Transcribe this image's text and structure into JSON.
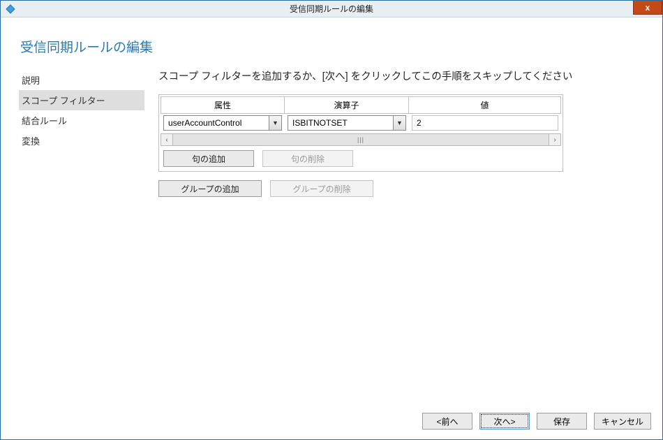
{
  "window": {
    "title": "受信同期ルールの編集",
    "close_label": "x"
  },
  "heading": "受信同期ルールの編集",
  "sidebar": {
    "items": [
      {
        "label": "説明",
        "selected": false
      },
      {
        "label": "スコープ フィルター",
        "selected": true
      },
      {
        "label": "結合ルール",
        "selected": false
      },
      {
        "label": "変換",
        "selected": false
      }
    ]
  },
  "content": {
    "instruction": "スコープ フィルターを追加するか、[次へ] をクリックしてこの手順をスキップしてください",
    "columns": {
      "attribute": "属性",
      "operator": "演算子",
      "value": "値"
    },
    "row": {
      "attribute": "userAccountControl",
      "operator": "ISBITNOTSET",
      "value": "2"
    },
    "clause_buttons": {
      "add": "句の追加",
      "remove": "句の削除"
    },
    "group_buttons": {
      "add": "グループの追加",
      "remove": "グループの削除"
    }
  },
  "footer": {
    "back": "<前へ",
    "next": "次へ>",
    "save": "保存",
    "cancel": "キャンセル"
  }
}
